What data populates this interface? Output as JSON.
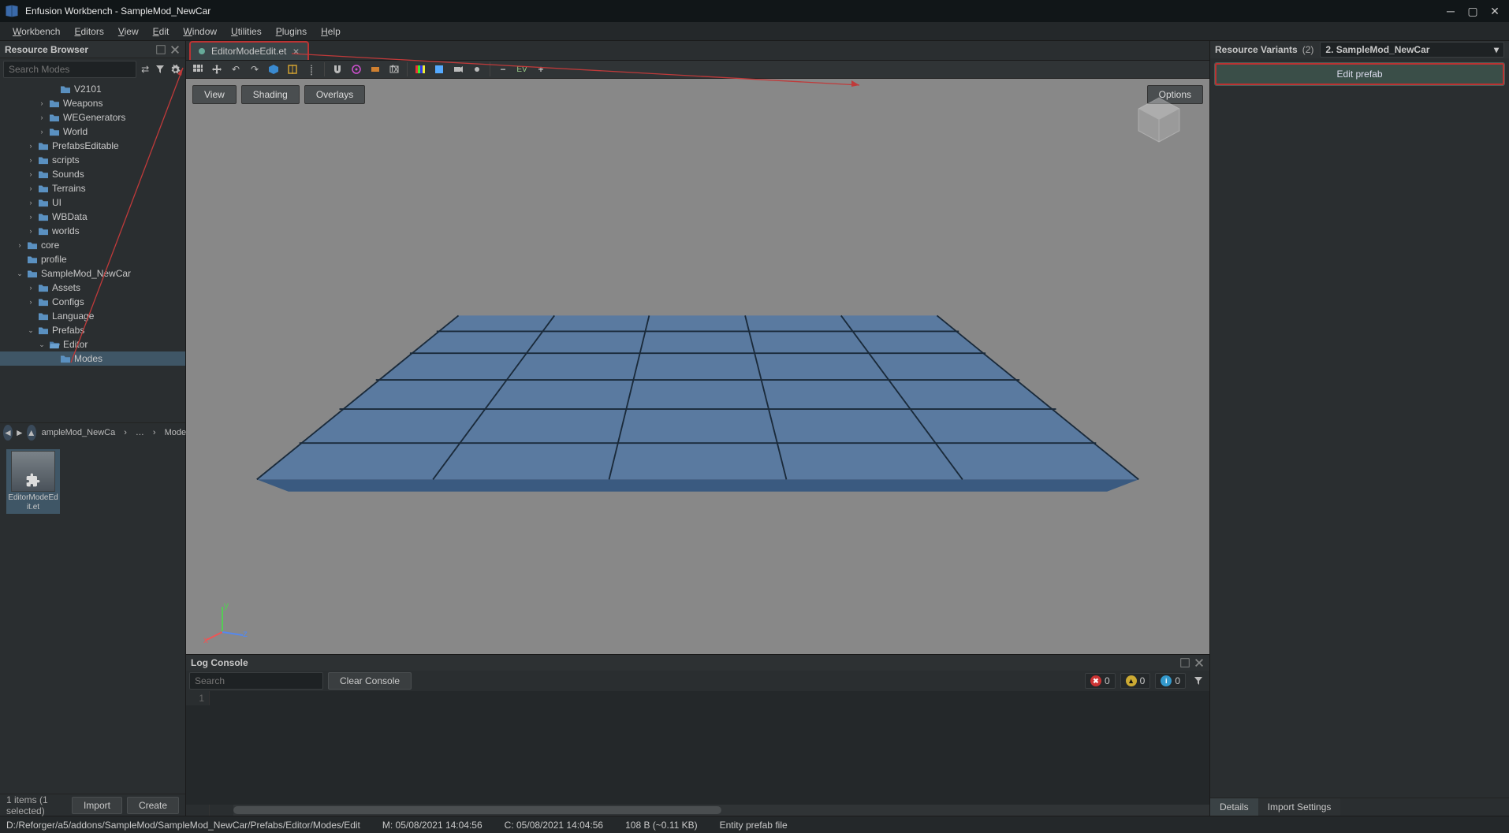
{
  "window": {
    "title": "Enfusion Workbench - SampleMod_NewCar"
  },
  "menubar": [
    "Workbench",
    "Editors",
    "View",
    "Edit",
    "Window",
    "Utilities",
    "Plugins",
    "Help"
  ],
  "resource_browser": {
    "title": "Resource Browser",
    "search_placeholder": "Search Modes",
    "tree": [
      {
        "depth": 4,
        "tw": "",
        "icon": "folder",
        "label": "V2101"
      },
      {
        "depth": 3,
        "tw": "›",
        "icon": "folder",
        "label": "Weapons"
      },
      {
        "depth": 3,
        "tw": "›",
        "icon": "folder",
        "label": "WEGenerators"
      },
      {
        "depth": 3,
        "tw": "›",
        "icon": "folder",
        "label": "World"
      },
      {
        "depth": 2,
        "tw": "›",
        "icon": "folder",
        "label": "PrefabsEditable"
      },
      {
        "depth": 2,
        "tw": "›",
        "icon": "folder",
        "label": "scripts"
      },
      {
        "depth": 2,
        "tw": "›",
        "icon": "folder",
        "label": "Sounds"
      },
      {
        "depth": 2,
        "tw": "›",
        "icon": "folder",
        "label": "Terrains"
      },
      {
        "depth": 2,
        "tw": "›",
        "icon": "folder",
        "label": "UI"
      },
      {
        "depth": 2,
        "tw": "›",
        "icon": "folder",
        "label": "WBData"
      },
      {
        "depth": 2,
        "tw": "›",
        "icon": "folder",
        "label": "worlds"
      },
      {
        "depth": 1,
        "tw": "›",
        "icon": "folder",
        "label": "core"
      },
      {
        "depth": 1,
        "tw": "",
        "icon": "folder",
        "label": "profile"
      },
      {
        "depth": 1,
        "tw": "⌄",
        "icon": "folder",
        "label": "SampleMod_NewCar"
      },
      {
        "depth": 2,
        "tw": "›",
        "icon": "folder",
        "label": "Assets"
      },
      {
        "depth": 2,
        "tw": "›",
        "icon": "folder",
        "label": "Configs"
      },
      {
        "depth": 2,
        "tw": "",
        "icon": "folder",
        "label": "Language"
      },
      {
        "depth": 2,
        "tw": "⌄",
        "icon": "folder",
        "label": "Prefabs"
      },
      {
        "depth": 3,
        "tw": "⌄",
        "icon": "folder-open",
        "label": "Editor"
      },
      {
        "depth": 4,
        "tw": "",
        "icon": "folder",
        "label": "Modes",
        "sel": true
      }
    ],
    "breadcrumb": [
      "ampleMod_NewCa",
      "…",
      "Mode:"
    ],
    "thumbnail": {
      "name": "EditorModeEdit.et"
    },
    "footer": {
      "info": "1 items (1 selected)",
      "import": "Import",
      "create": "Create"
    }
  },
  "editor": {
    "tab": {
      "name": "EditorModeEdit.et"
    },
    "viewport_buttons": [
      "View",
      "Shading",
      "Overlays"
    ],
    "options": "Options",
    "toolbar_icons": [
      "grid",
      "move",
      "undo",
      "redo",
      "cube",
      "bounds",
      "snap",
      "magnet",
      "ground",
      "distance",
      "fx",
      "color",
      "shading",
      "camera",
      "overlay",
      "minus",
      "env",
      "plus"
    ]
  },
  "right": {
    "title": "Resource Variants",
    "count": "(2)",
    "selected_variant": "2. SampleMod_NewCar",
    "edit_prefab": "Edit prefab",
    "tabs": [
      "Details",
      "Import Settings"
    ]
  },
  "log": {
    "title": "Log Console",
    "search_placeholder": "Search",
    "clear": "Clear Console",
    "counts": {
      "error": "0",
      "warn": "0",
      "info": "0"
    },
    "line1": "1"
  },
  "statusbar": {
    "path": "D:/Reforger/a5/addons/SampleMod/SampleMod_NewCar/Prefabs/Editor/Modes/Edit",
    "modified": "M: 05/08/2021 14:04:56",
    "created": "C: 05/08/2021 14:04:56",
    "size": "108 B (~0.11 KB)",
    "type": "Entity prefab file"
  },
  "colors": {
    "accent_blue": "#4a6a8a",
    "folder": "#5a90c0",
    "highlight_red": "#c03a3a"
  }
}
